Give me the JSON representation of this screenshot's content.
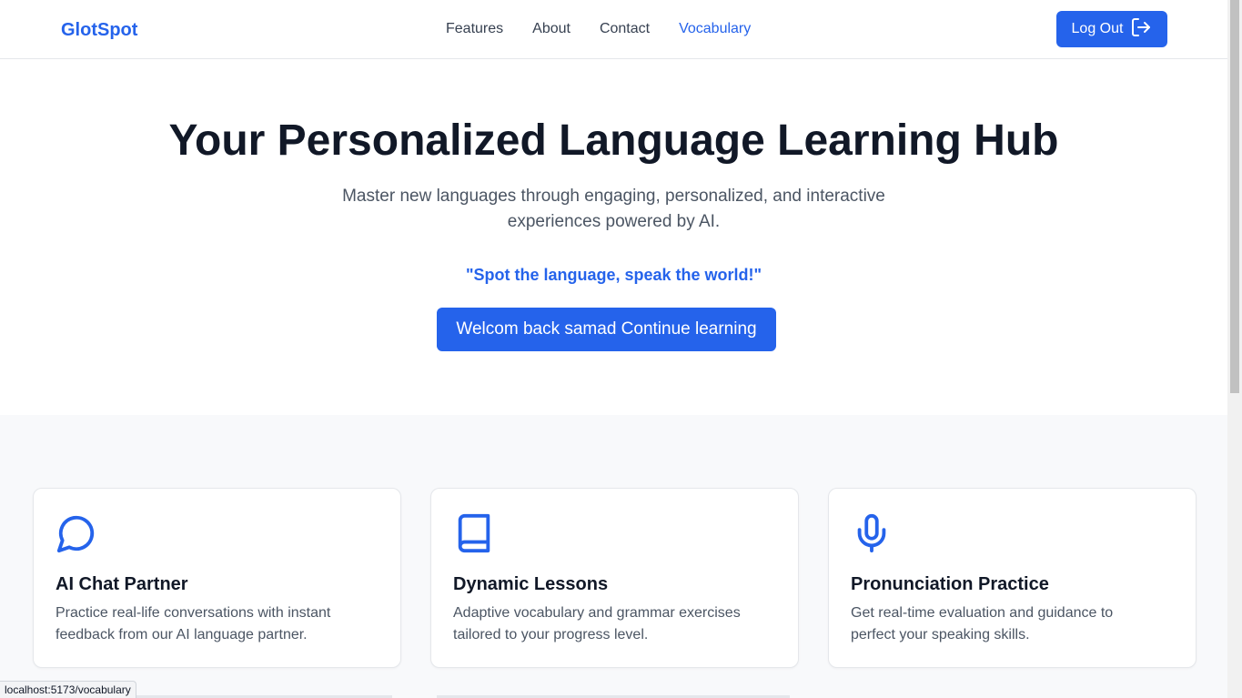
{
  "header": {
    "brand": "GlotSpot",
    "nav": [
      {
        "label": "Features"
      },
      {
        "label": "About"
      },
      {
        "label": "Contact"
      },
      {
        "label": "Vocabulary"
      }
    ],
    "logout_label": "Log Out"
  },
  "hero": {
    "title": "Your Personalized Language Learning Hub",
    "subtitle": "Master new languages through engaging, personalized, and interactive experiences powered by AI.",
    "quote": "\"Spot the language, speak the world!\"",
    "cta_label": "Welcom back samad Continue learning"
  },
  "features": [
    {
      "icon": "chat-bubble-icon",
      "title": "AI Chat Partner",
      "description": "Practice real-life conversations with instant feedback from our AI language partner."
    },
    {
      "icon": "book-icon",
      "title": "Dynamic Lessons",
      "description": "Adaptive vocabulary and grammar exercises tailored to your progress level."
    },
    {
      "icon": "microphone-icon",
      "title": "Pronunciation Practice",
      "description": "Get real-time evaluation and guidance to perfect your speaking skills."
    }
  ],
  "status_bar": {
    "url": "localhost:5173/vocabulary"
  },
  "colors": {
    "accent": "#2563eb",
    "text": "#111827",
    "muted": "#4b5563",
    "section_bg": "#f8f9fb"
  }
}
